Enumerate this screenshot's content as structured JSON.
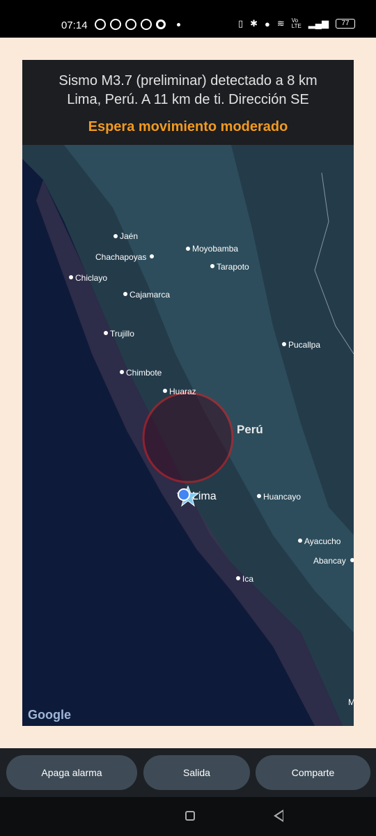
{
  "status_bar": {
    "time": "07:14",
    "left_icons": [
      "whatsapp-icon",
      "facebook-icon",
      "target-icon",
      "facebook-icon",
      "app-a-icon",
      "dot-icon"
    ],
    "right_icons": [
      "vibrate-icon",
      "bluetooth-icon",
      "location-icon",
      "wifi-icon",
      "volte-icon",
      "signal-icon"
    ],
    "volte_text": "Vo LTE",
    "battery": "77"
  },
  "alert": {
    "line1": "Sismo M3.7 (preliminar) detectado a 8 km",
    "line2": "Lima, Perú. A 11 km de ti. Dirección SE",
    "warning": "Espera movimiento moderado",
    "warning_color": "#f39a1f"
  },
  "map": {
    "country": "Perú",
    "cities": {
      "jaen": "Jaén",
      "moyobamba": "Moyobamba",
      "chachapoyas": "Chachapoyas",
      "tarapoto": "Tarapoto",
      "chiclayo": "Chiclayo",
      "cajamarca": "Cajamarca",
      "trujillo": "Trujillo",
      "pucallpa": "Pucallpa",
      "chimbote": "Chimbote",
      "huaraz": "Huaraz",
      "lima": "Lima",
      "huancayo": "Huancayo",
      "ayacucho": "Ayacucho",
      "abancay": "Abancay",
      "ica": "Ica"
    },
    "edge_letter": "M",
    "attribution": "Google",
    "epicenter_ring_color": "#e01b1b"
  },
  "actions": {
    "stop_alarm": "Apaga alarma",
    "exit": "Salida",
    "share": "Comparte"
  }
}
